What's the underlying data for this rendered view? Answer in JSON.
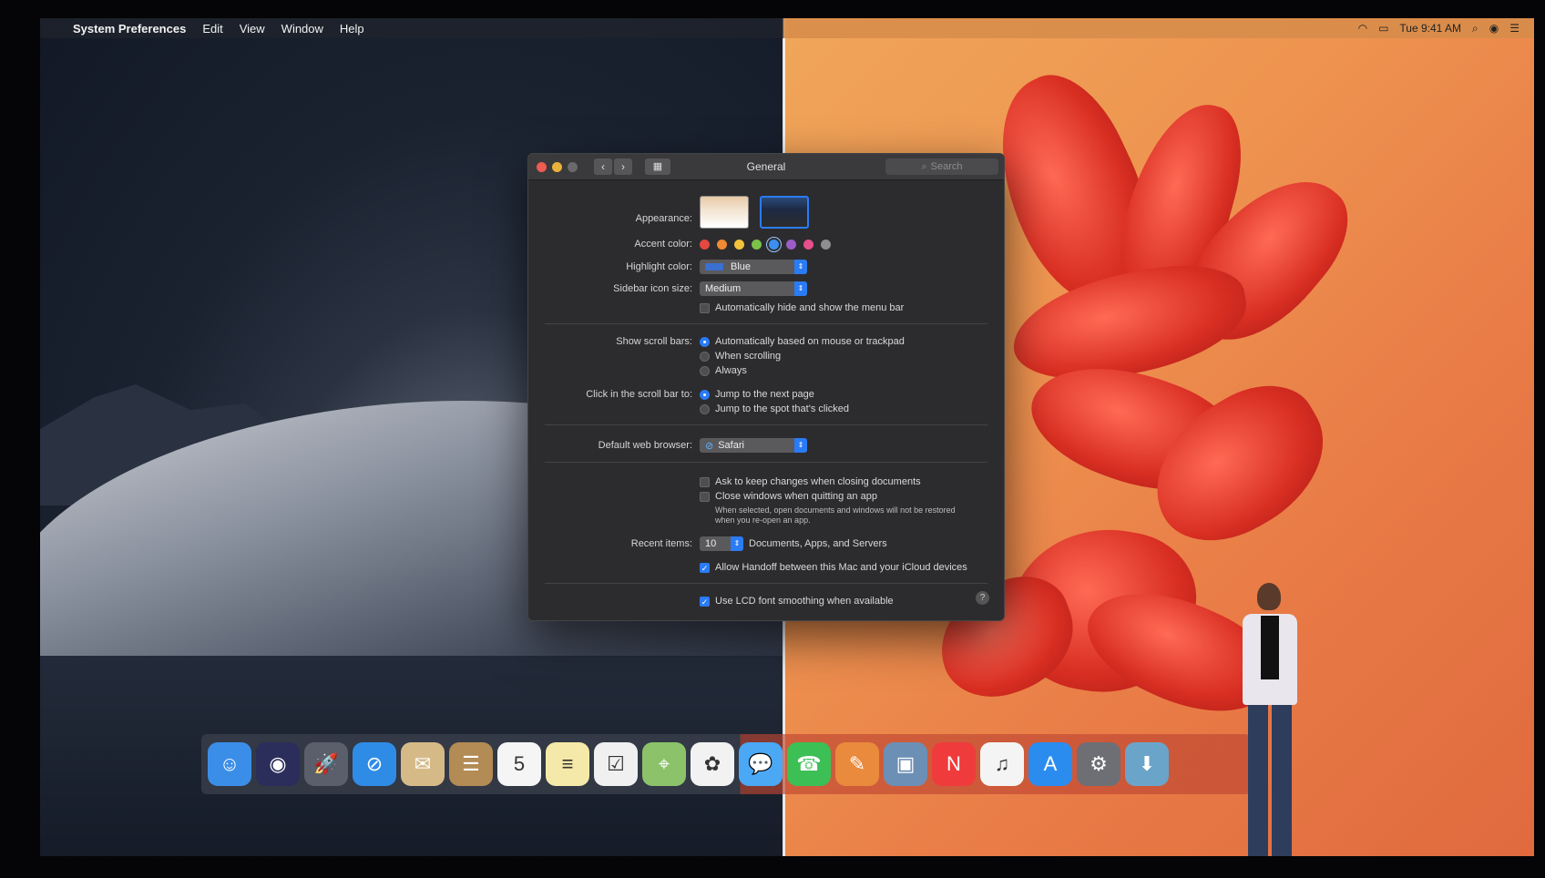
{
  "menubar": {
    "app_name": "System Preferences",
    "menus": [
      "Edit",
      "View",
      "Window",
      "Help"
    ],
    "clock": "Tue 9:41 AM",
    "icons": [
      "wifi-icon",
      "airplay-icon",
      "spotlight-icon",
      "siri-icon",
      "notification-center-icon"
    ]
  },
  "window": {
    "title": "General",
    "search_placeholder": "Search",
    "appearance_label": "Appearance:",
    "accent_label": "Accent color:",
    "accent_colors": [
      "#e5483f",
      "#f08a33",
      "#f2c33a",
      "#7cc24a",
      "#3b8ff0",
      "#9b5cc8",
      "#e6508c",
      "#8e8e90"
    ],
    "highlight_label": "Highlight color:",
    "highlight_value": "Blue",
    "sidebar_label": "Sidebar icon size:",
    "sidebar_value": "Medium",
    "auto_hide_menu": "Automatically hide and show the menu bar",
    "scroll_bars_label": "Show scroll bars:",
    "scroll_opt1": "Automatically based on mouse or trackpad",
    "scroll_opt2": "When scrolling",
    "scroll_opt3": "Always",
    "click_label": "Click in the scroll bar to:",
    "click_opt1": "Jump to the next page",
    "click_opt2": "Jump to the spot that's clicked",
    "browser_label": "Default web browser:",
    "browser_value": "Safari",
    "ask_keep": "Ask to keep changes when closing documents",
    "close_windows": "Close windows when quitting an app",
    "close_note_1": "When selected, open documents and windows will not be restored",
    "close_note_2": "when you re-open an app.",
    "recent_label": "Recent items:",
    "recent_value": "10",
    "recent_suffix": "Documents, Apps, and Servers",
    "handoff": "Allow Handoff between this Mac and your iCloud devices",
    "lcd": "Use LCD font smoothing when available",
    "help": "?"
  },
  "dock": {
    "apps": [
      {
        "name": "finder-icon",
        "color": "#3b8ee8",
        "glyph": "☺"
      },
      {
        "name": "siri-icon",
        "color": "#2b2d5a",
        "glyph": "◉"
      },
      {
        "name": "launchpad-icon",
        "color": "#5a5f6b",
        "glyph": "🚀"
      },
      {
        "name": "safari-icon",
        "color": "#2f8ce6",
        "glyph": "⊘"
      },
      {
        "name": "mail-icon",
        "color": "#d5ba88",
        "glyph": "✉"
      },
      {
        "name": "contacts-icon",
        "color": "#b28b55",
        "glyph": "☰"
      },
      {
        "name": "calendar-icon",
        "color": "#f5f5f5",
        "glyph": "5"
      },
      {
        "name": "notes-icon",
        "color": "#f4e9a8",
        "glyph": "≡"
      },
      {
        "name": "reminders-icon",
        "color": "#f0f0f0",
        "glyph": "☑"
      },
      {
        "name": "maps-icon",
        "color": "#8cc36a",
        "glyph": "⌖"
      },
      {
        "name": "photos-icon",
        "color": "#f2f2f2",
        "glyph": "✿"
      },
      {
        "name": "messages-icon",
        "color": "#4aa8f5",
        "glyph": "💬"
      },
      {
        "name": "facetime-icon",
        "color": "#3cbf55",
        "glyph": "☎"
      },
      {
        "name": "pages-icon",
        "color": "#e98a3c",
        "glyph": "✎"
      },
      {
        "name": "preview-icon",
        "color": "#6c8fb5",
        "glyph": "▣"
      },
      {
        "name": "news-icon",
        "color": "#ef3b3b",
        "glyph": "N"
      },
      {
        "name": "music-icon",
        "color": "#f4f4f4",
        "glyph": "♫"
      },
      {
        "name": "app-store-icon",
        "color": "#2b8cf0",
        "glyph": "A"
      },
      {
        "name": "system-preferences-icon",
        "color": "#6d6f75",
        "glyph": "⚙"
      },
      {
        "name": "downloads-folder-icon",
        "color": "#6ba4c9",
        "glyph": "⬇"
      }
    ]
  }
}
